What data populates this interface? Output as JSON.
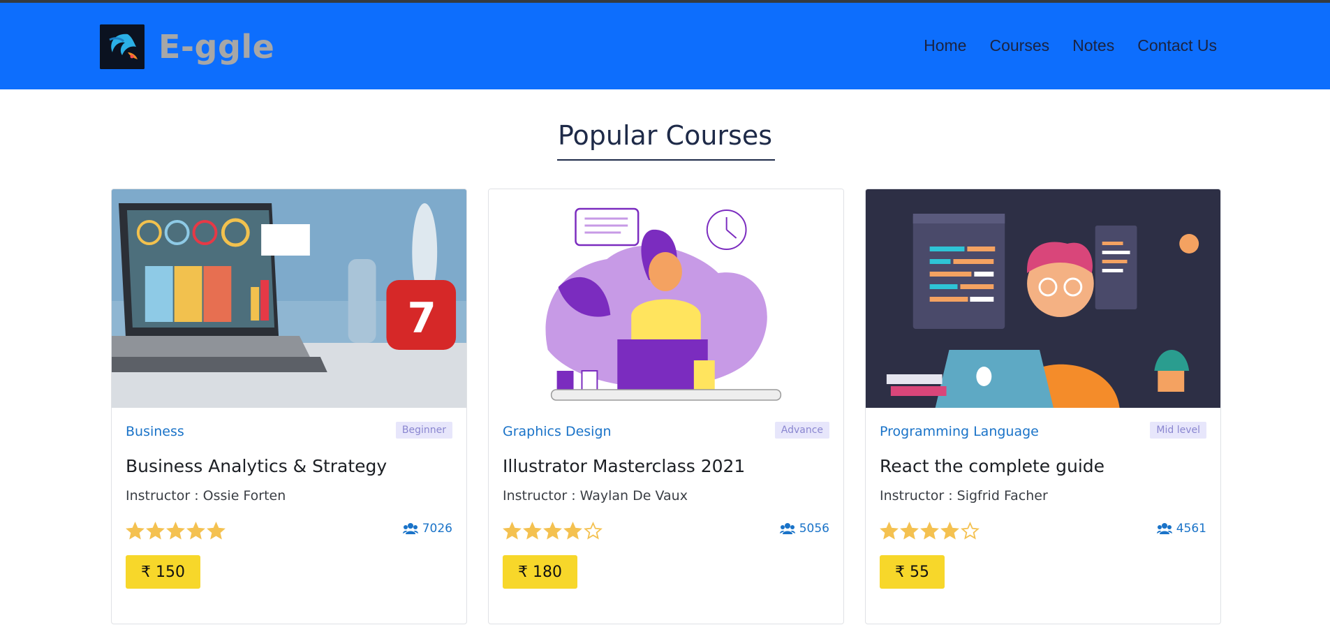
{
  "header": {
    "brand": "E-ggle",
    "nav": [
      "Home",
      "Courses",
      "Notes",
      "Contact Us"
    ]
  },
  "section_title": "Popular Courses",
  "courses": [
    {
      "category": "Business",
      "level": "Beginner",
      "title": "Business Analytics & Strategy",
      "instructor": "Instructor : Ossie Forten",
      "rating": 5,
      "students": "7026",
      "price": "₹ 150"
    },
    {
      "category": "Graphics Design",
      "level": "Advance",
      "title": "Illustrator Masterclass 2021",
      "instructor": "Instructor : Waylan De Vaux",
      "rating": 4,
      "students": "5056",
      "price": "₹ 180"
    },
    {
      "category": "Programming Language",
      "level": "Mid level",
      "title": "React the complete guide",
      "instructor": "Instructor : Sigfrid Facher",
      "rating": 4,
      "students": "4561",
      "price": "₹ 55"
    }
  ],
  "colors": {
    "navbar": "#0d6efd",
    "accent": "#1a73c8",
    "price": "#f7d72a",
    "star": "#f4c150"
  }
}
